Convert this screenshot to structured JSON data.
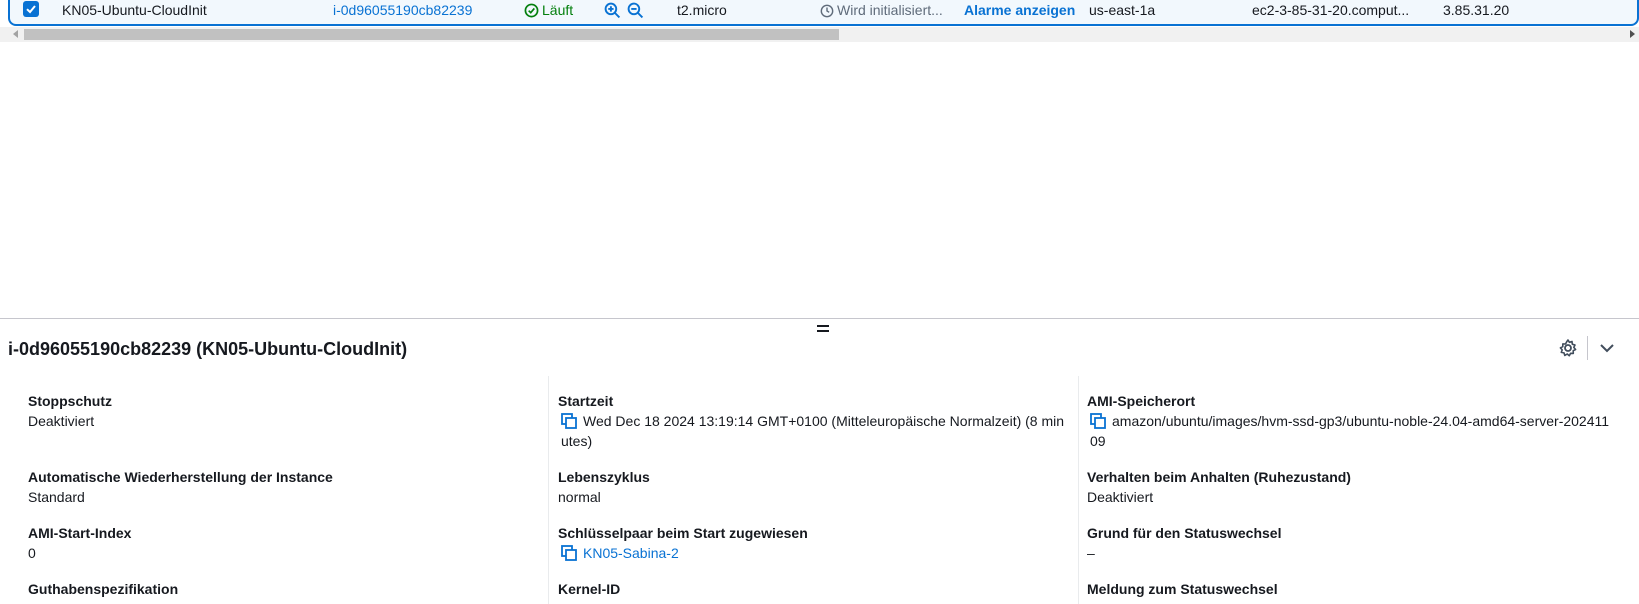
{
  "table_row": {
    "selected": true,
    "name": "KN05-Ubuntu-CloudInit",
    "instance_id": "i-0d96055190cb82239",
    "state": "Läuft",
    "instance_type": "t2.micro",
    "status_check": "Wird initialisiert...",
    "alarm_link": "Alarme anzeigen",
    "availability_zone": "us-east-1a",
    "public_dns": "ec2-3-85-31-20.comput...",
    "public_ip": "3.85.31.20"
  },
  "details": {
    "title": "i-0d96055190cb82239 (KN05-Ubuntu-CloudInit)",
    "col1": {
      "stop_protection_label": "Stoppschutz",
      "stop_protection_value": "Deaktiviert",
      "auto_recovery_label": "Automatische Wiederherstellung der Instance",
      "auto_recovery_value": "Standard",
      "ami_launch_index_label": "AMI-Start-Index",
      "ami_launch_index_value": "0",
      "credit_spec_label": "Guthabenspezifikation"
    },
    "col2": {
      "launch_time_label": "Startzeit",
      "launch_time_value": "Wed Dec 18 2024 13:19:14 GMT+0100 (Mitteleuropäische Normalzeit) (8 minutes)",
      "lifecycle_label": "Lebenszyklus",
      "lifecycle_value": "normal",
      "key_pair_label": "Schlüsselpaar beim Start zugewiesen",
      "key_pair_value": "KN05-Sabina-2",
      "kernel_id_label": "Kernel-ID"
    },
    "col3": {
      "ami_location_label": "AMI-Speicherort",
      "ami_location_value": "amazon/ubuntu/images/hvm-ssd-gp3/ubuntu-noble-24.04-amd64-server-20241109",
      "stop_hibernate_label": "Verhalten beim Anhalten (Ruhezustand)",
      "stop_hibernate_value": "Deaktiviert",
      "state_reason_label": "Grund für den Statuswechsel",
      "state_reason_value": "–",
      "state_message_label": "Meldung zum Statuswechsel"
    }
  },
  "colors": {
    "accent": "#0972d3",
    "success": "#037f0c",
    "selected_bg": "#f2f8fd"
  },
  "icons": {
    "checkbox": "check-icon",
    "state": "check-circle-icon",
    "zoom_in": "zoom-in-icon",
    "zoom_out": "zoom-out-icon",
    "status_pending": "clock-icon",
    "copy": "copy-icon",
    "settings": "gear-icon",
    "collapse": "chevron-down-icon"
  }
}
